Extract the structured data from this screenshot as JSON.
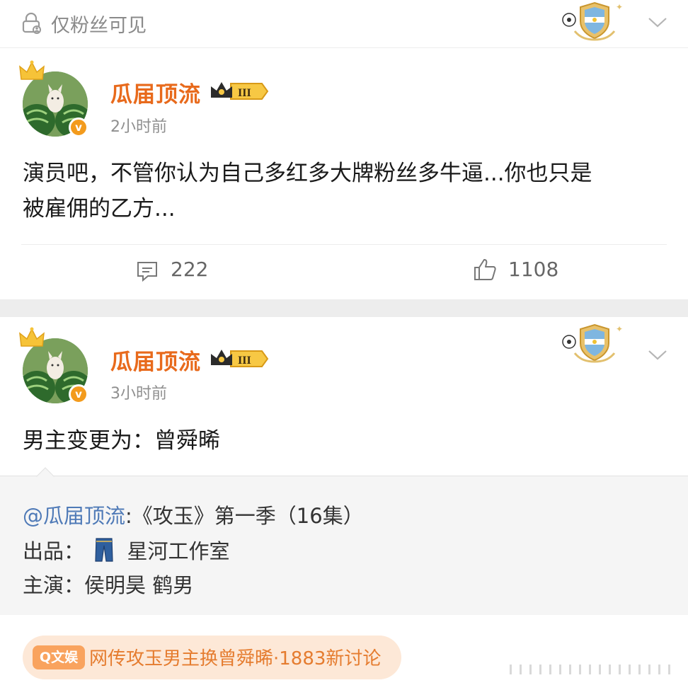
{
  "top_bar": {
    "visibility": "仅粉丝可见"
  },
  "post1": {
    "username": "瓜届顶流",
    "rank_badge": "III",
    "time": "2小时前",
    "content_line1": "演员吧，不管你认为自己多红多大牌粉丝多牛逼...你也只是",
    "content_line2": "被雇佣的乙方...",
    "comment_count": "222",
    "like_count": "1108"
  },
  "post2": {
    "username": "瓜届顶流",
    "rank_badge": "III",
    "time": "3小时前",
    "content": "男主变更为：曾舜晞",
    "quote": {
      "mention": "@瓜届顶流",
      "line1_rest": ":《攻玉》第一季（16集）",
      "line2_label": "出品：",
      "line2_value": "星河工作室",
      "line3": "主演：侯明昊 鹤男"
    }
  },
  "topic": {
    "tag": "Q文娱",
    "text": "网传攻玉男主换曾舜晞·1883新讨论"
  },
  "colors": {
    "username": "#e86a1c",
    "mention": "#4f7ab7",
    "topic_text": "#e57c2f",
    "topic_bg": "#fde8d7"
  }
}
